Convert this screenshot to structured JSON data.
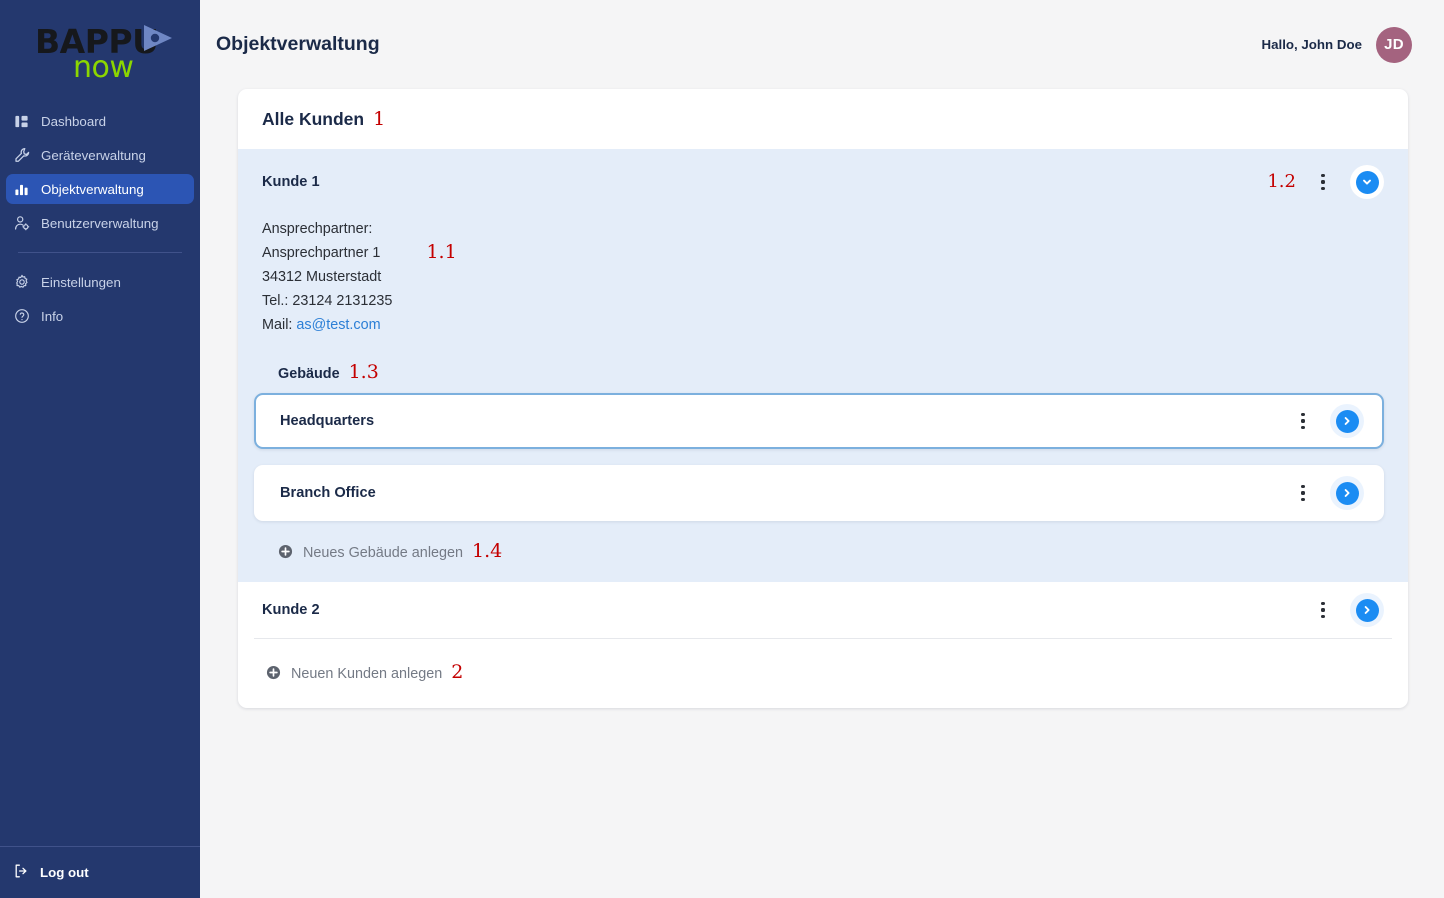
{
  "sidebar": {
    "logo": {
      "brand": "BAPPU",
      "sub": "now",
      "play_icon": "play-triangle-icon"
    },
    "items": [
      {
        "label": "Dashboard",
        "icon": "dashboard-icon",
        "active": false
      },
      {
        "label": "Geräteverwaltung",
        "icon": "wrench-icon",
        "active": false
      },
      {
        "label": "Objektverwaltung",
        "icon": "bar-chart-icon",
        "active": true
      },
      {
        "label": "Benutzerverwaltung",
        "icon": "user-gear-icon",
        "active": false
      }
    ],
    "secondary_items": [
      {
        "label": "Einstellungen",
        "icon": "gear-icon"
      },
      {
        "label": "Info",
        "icon": "question-circle-icon"
      }
    ],
    "logout": {
      "label": "Log out",
      "icon": "logout-icon"
    }
  },
  "header": {
    "title": "Objektverwaltung",
    "greeting": "Hallo, John Doe",
    "avatar_initials": "JD"
  },
  "main": {
    "card_title": "Alle Kunden",
    "card_title_anno": "1",
    "customers": [
      {
        "name": "Kunde 1",
        "anno_actions": "1.2",
        "expanded": true,
        "toggle_icon": "chevron-down-icon",
        "kebab_icon": "kebab-menu-icon",
        "contact": {
          "anno": "1.1",
          "label": "Ansprechpartner:",
          "person": "Ansprechpartner 1",
          "address": "34312 Musterstadt",
          "phone": "Tel.: 23124 2131235",
          "mail_label": "Mail:",
          "mail": "as@test.com"
        },
        "buildings_label": "Gebäude",
        "buildings_anno": "1.3",
        "buildings": [
          {
            "name": "Headquarters",
            "selected": true,
            "toggle_icon": "chevron-right-icon",
            "kebab_icon": "kebab-menu-icon"
          },
          {
            "name": "Branch Office",
            "selected": false,
            "toggle_icon": "chevron-right-icon",
            "kebab_icon": "kebab-menu-icon"
          }
        ],
        "add_building": {
          "label": "Neues Gebäude anlegen",
          "anno": "1.4",
          "icon": "plus-circle-icon"
        }
      },
      {
        "name": "Kunde 2",
        "expanded": false,
        "toggle_icon": "chevron-right-icon",
        "kebab_icon": "kebab-menu-icon"
      }
    ],
    "add_customer": {
      "label": "Neuen Kunden anlegen",
      "anno": "2",
      "icon": "plus-circle-icon"
    }
  },
  "colors": {
    "sidebar_bg": "#24386e",
    "sidebar_active": "#2c55b4",
    "accent_blue": "#1b8cf3",
    "panel_blue": "#e4edf9",
    "page_bg": "#f5f5f6",
    "annotation_red": "#c40000",
    "logo_green": "#8cd600",
    "avatar_bg": "#a4637f",
    "link_blue": "#2c7fd6"
  }
}
